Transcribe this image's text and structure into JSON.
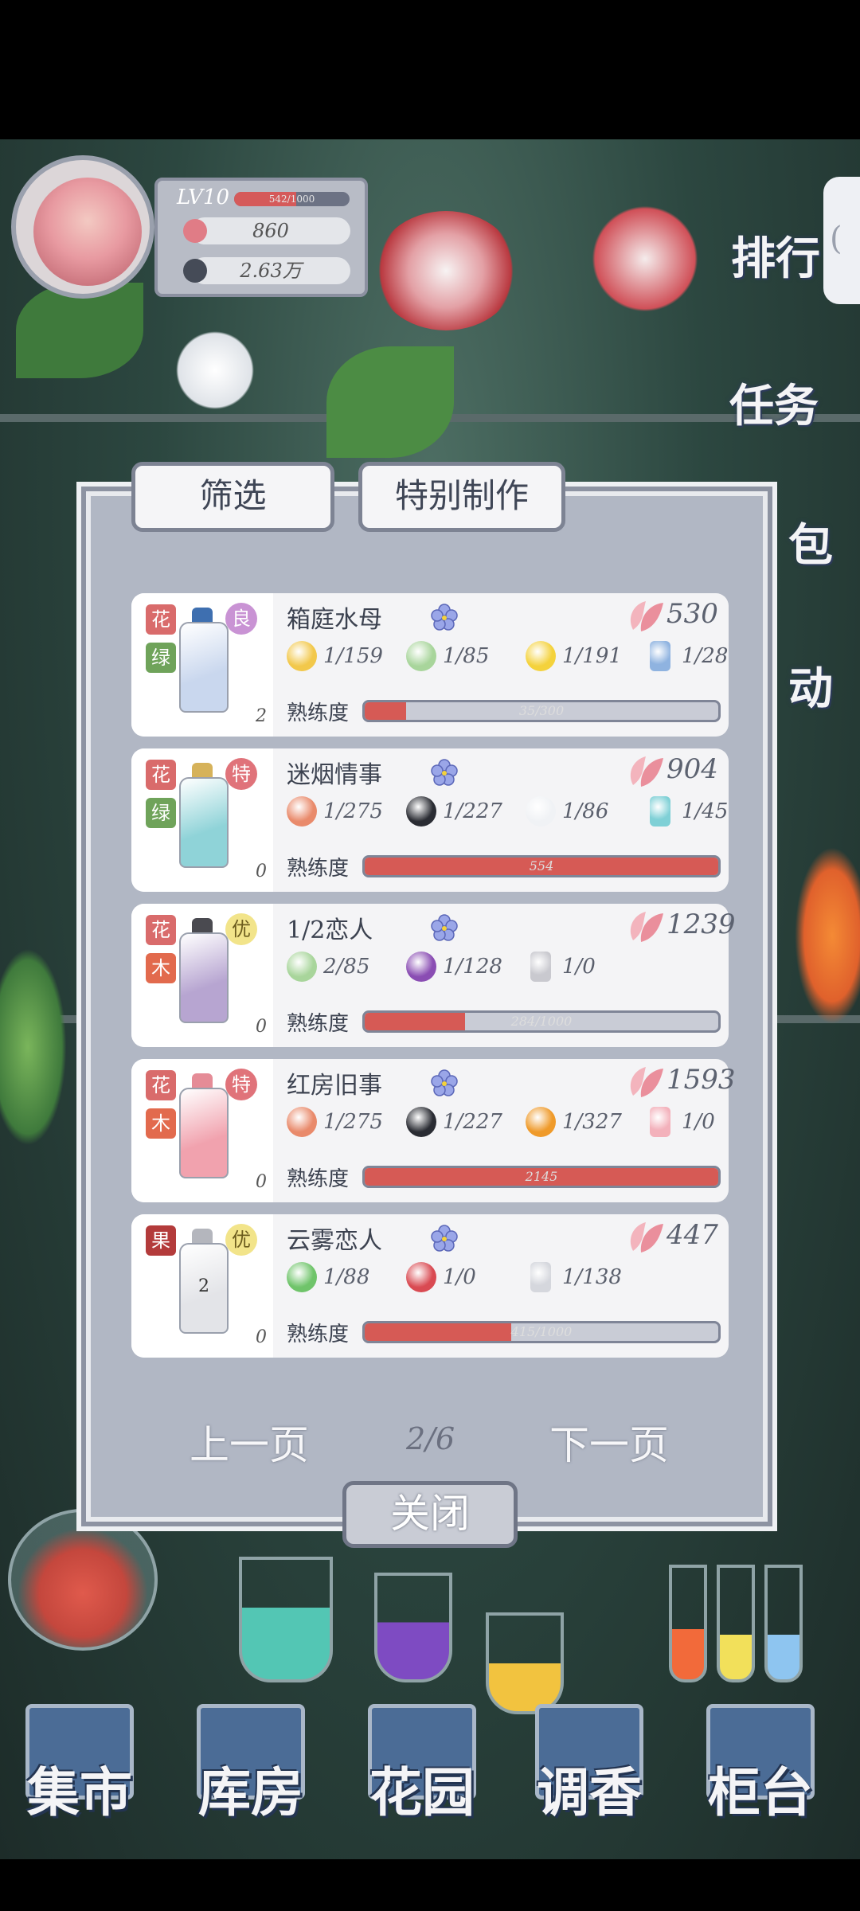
{
  "player": {
    "level": "LV10",
    "xp_text": "542/1000",
    "xp_fraction": 0.54,
    "petals": "860",
    "money": "2.63万"
  },
  "side_menu": {
    "tab_glyph": "(",
    "rank": "排行",
    "tasks": "任务",
    "bag": "包",
    "event": "动"
  },
  "dialog": {
    "tab_filter": "筛选",
    "tab_special": "特别制作",
    "prev_page": "上一页",
    "page": "2/6",
    "next_page": "下一页",
    "close": "关闭",
    "proficiency_label": "熟练度",
    "items": [
      {
        "tags": [
          {
            "text": "花",
            "color": "#d96b6b"
          },
          {
            "text": "绿",
            "color": "#6fa35a"
          }
        ],
        "grade": "良",
        "grade_color": "#c993d4",
        "bottle_color": "#c9d7ee",
        "cap_color": "#3e6fb0",
        "stock": "2",
        "name": "箱庭水母",
        "price": "530",
        "ingredients": [
          {
            "icon": "yellow-flower-icon",
            "color": "#f2c84b",
            "text": "1/159"
          },
          {
            "icon": "green-rose-icon",
            "color": "#a8d59b",
            "text": "1/85"
          },
          {
            "icon": "lemon-icon",
            "color": "#f4d23c",
            "text": "1/191"
          },
          {
            "icon": "blue-bottle-icon",
            "color": "#8fb3e0",
            "text": "1/28"
          }
        ],
        "proficiency_text": "35/300",
        "proficiency": 0.117
      },
      {
        "tags": [
          {
            "text": "花",
            "color": "#d96b6b"
          },
          {
            "text": "绿",
            "color": "#6fa35a"
          }
        ],
        "grade": "特",
        "grade_color": "#e0737a",
        "bottle_color": "#8fd3d8",
        "cap_color": "#d6b25a",
        "stock": "0",
        "name": "迷烟情事",
        "price": "904",
        "ingredients": [
          {
            "icon": "orange-rose-icon",
            "color": "#e98a6b",
            "text": "1/275"
          },
          {
            "icon": "black-rose-icon",
            "color": "#2a2c33",
            "text": "1/227"
          },
          {
            "icon": "white-rose-icon",
            "color": "#f0f2f5",
            "text": "1/86"
          },
          {
            "icon": "teal-bottle-icon",
            "color": "#7fd0d6",
            "text": "1/45"
          }
        ],
        "proficiency_text": "554",
        "proficiency": 1.0
      },
      {
        "tags": [
          {
            "text": "花",
            "color": "#d96b6b"
          },
          {
            "text": "木",
            "color": "#e26a4d"
          }
        ],
        "grade": "优",
        "grade_color": "#f2e48a",
        "bottle_color": "#b7a5d1",
        "cap_color": "#4a4a50",
        "stock": "0",
        "name": "1/2恋人",
        "price": "1239",
        "ingredients": [
          {
            "icon": "green-rose-icon",
            "color": "#a8d59b",
            "text": "2/85"
          },
          {
            "icon": "purple-flower-icon",
            "color": "#8a4db3",
            "text": "1/128"
          },
          {
            "icon": "gray-bottle-icon",
            "color": "#c9c9cf",
            "text": "1/0"
          }
        ],
        "proficiency_text": "284/1000",
        "proficiency": 0.284
      },
      {
        "tags": [
          {
            "text": "花",
            "color": "#d96b6b"
          },
          {
            "text": "木",
            "color": "#e26a4d"
          }
        ],
        "grade": "特",
        "grade_color": "#e0737a",
        "bottle_color": "#f1a2ae",
        "cap_color": "#e58c97",
        "stock": "0",
        "name": "红房旧事",
        "price": "1593",
        "ingredients": [
          {
            "icon": "orange-rose-icon",
            "color": "#e98a6b",
            "text": "1/275"
          },
          {
            "icon": "black-rose-icon",
            "color": "#2a2c33",
            "text": "1/227"
          },
          {
            "icon": "kumquat-icon",
            "color": "#ef9a2a",
            "text": "1/327"
          },
          {
            "icon": "pink-bottle-icon",
            "color": "#f3b1bb",
            "text": "1/0"
          }
        ],
        "proficiency_text": "2145",
        "proficiency": 1.0
      },
      {
        "tags": [
          {
            "text": "果",
            "color": "#b33b3b"
          }
        ],
        "grade": "优",
        "grade_color": "#f2e48a",
        "bottle_color": "#e3e4e8",
        "cap_color": "#b4b6bd",
        "stock": "0",
        "bottle_label": "2",
        "name": "云雾恋人",
        "price": "447",
        "ingredients": [
          {
            "icon": "mint-leaf-icon",
            "color": "#6fc46a",
            "text": "1/88"
          },
          {
            "icon": "lychee-icon",
            "color": "#d94a52",
            "text": "1/0"
          },
          {
            "icon": "silver-bottle-icon",
            "color": "#d5d7dd",
            "text": "1/138"
          }
        ],
        "proficiency_text": "415/1000",
        "proficiency": 0.415
      }
    ]
  },
  "bottom_nav": [
    {
      "label": "集市",
      "icon": "market-gate-icon"
    },
    {
      "label": "库房",
      "icon": "warehouse-icon"
    },
    {
      "label": "花园",
      "icon": "rose-icon"
    },
    {
      "label": "调香",
      "icon": "perfume-mixer-icon"
    },
    {
      "label": "柜台",
      "icon": "counter-icon"
    }
  ],
  "colors": {
    "accent_red": "#d65a55",
    "dialog_bg": "#b1b7c4",
    "card_bg": "#f4f4f6",
    "nav_blue": "#4b6c96"
  }
}
